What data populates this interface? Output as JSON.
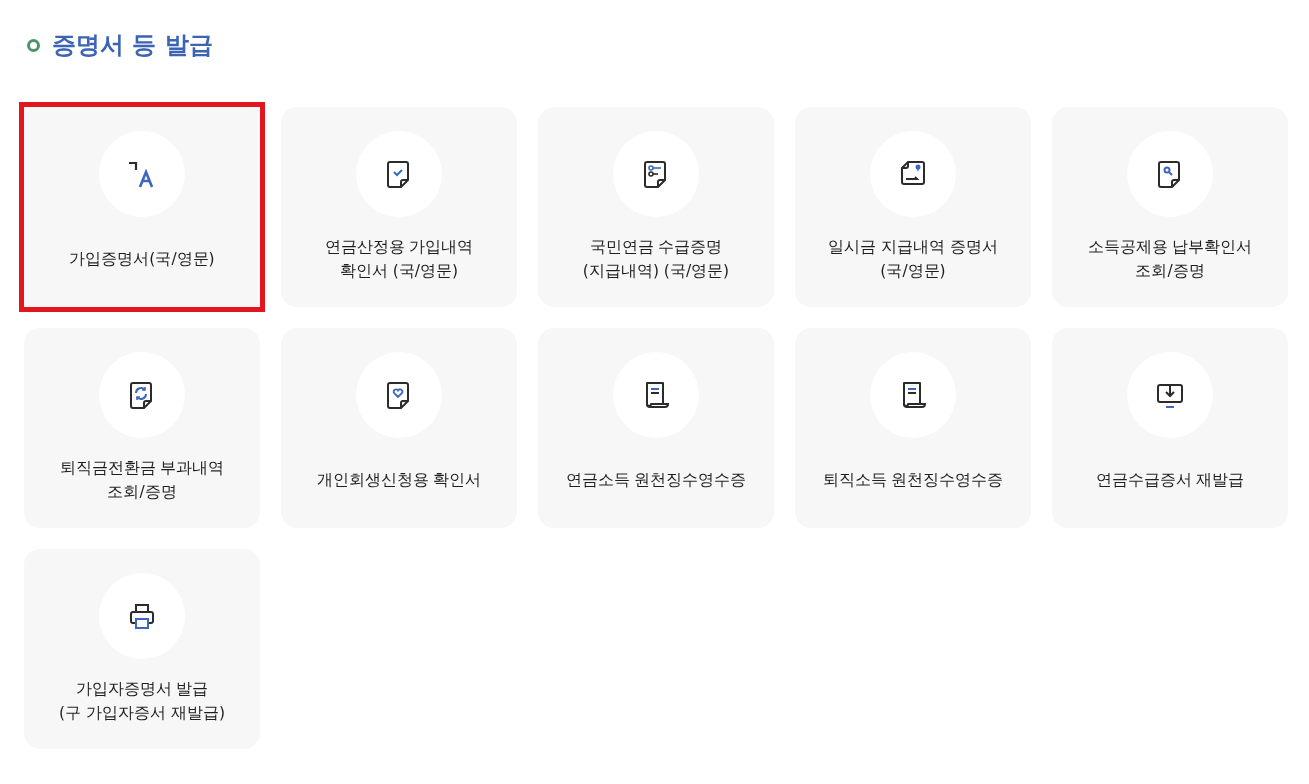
{
  "section": {
    "title": "증명서 등 발급"
  },
  "cards": [
    {
      "label": "가입증명서(국/영문)",
      "selected": true
    },
    {
      "label": "연금산정용 가입내역\n확인서 (국/영문)",
      "selected": false
    },
    {
      "label": "국민연금 수급증명\n(지급내역) (국/영문)",
      "selected": false
    },
    {
      "label": "일시금 지급내역 증명서\n(국/영문)",
      "selected": false
    },
    {
      "label": "소득공제용 납부확인서\n조회/증명",
      "selected": false
    },
    {
      "label": "퇴직금전환금 부과내역\n조회/증명",
      "selected": false
    },
    {
      "label": "개인회생신청용 확인서",
      "selected": false
    },
    {
      "label": "연금소득 원천징수영수증",
      "selected": false
    },
    {
      "label": "퇴직소득 원천징수영수증",
      "selected": false
    },
    {
      "label": "연금수급증서 재발급",
      "selected": false
    },
    {
      "label": "가입자증명서 발급\n(구 가입자증서 재발급)",
      "selected": false
    }
  ]
}
